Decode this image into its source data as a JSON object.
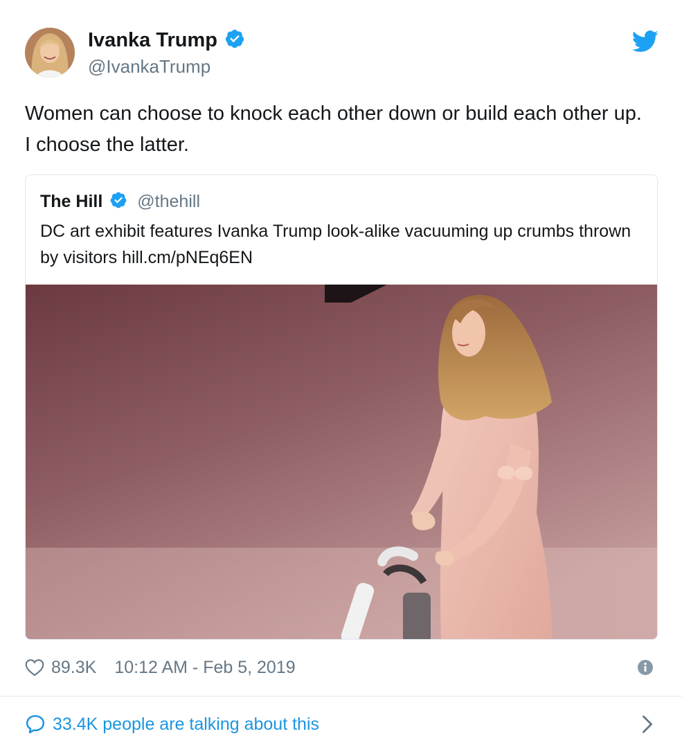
{
  "author": {
    "name": "Ivanka Trump",
    "handle": "@IvankaTrump",
    "verified": true
  },
  "tweet": {
    "text": "Women can choose to knock each other down or build each other up. I choose the latter."
  },
  "quoted_tweet": {
    "name": "The Hill",
    "handle": "@thehill",
    "verified": true,
    "text": "DC art exhibit features Ivanka Trump look-alike vacuuming up crumbs thrown by visitors hill.cm/pNEq6EN"
  },
  "meta": {
    "likes": "89.3K",
    "timestamp": "10:12 AM - Feb 5, 2019"
  },
  "footer": {
    "talking": "33.4K people are talking about this"
  },
  "colors": {
    "twitter_blue": "#1da1f2",
    "link_blue": "#1b95e0",
    "secondary_text": "#657786"
  },
  "icons": [
    "verified-icon",
    "twitter-logo-icon",
    "heart-icon",
    "info-icon",
    "speech-bubble-icon",
    "chevron-right-icon"
  ]
}
